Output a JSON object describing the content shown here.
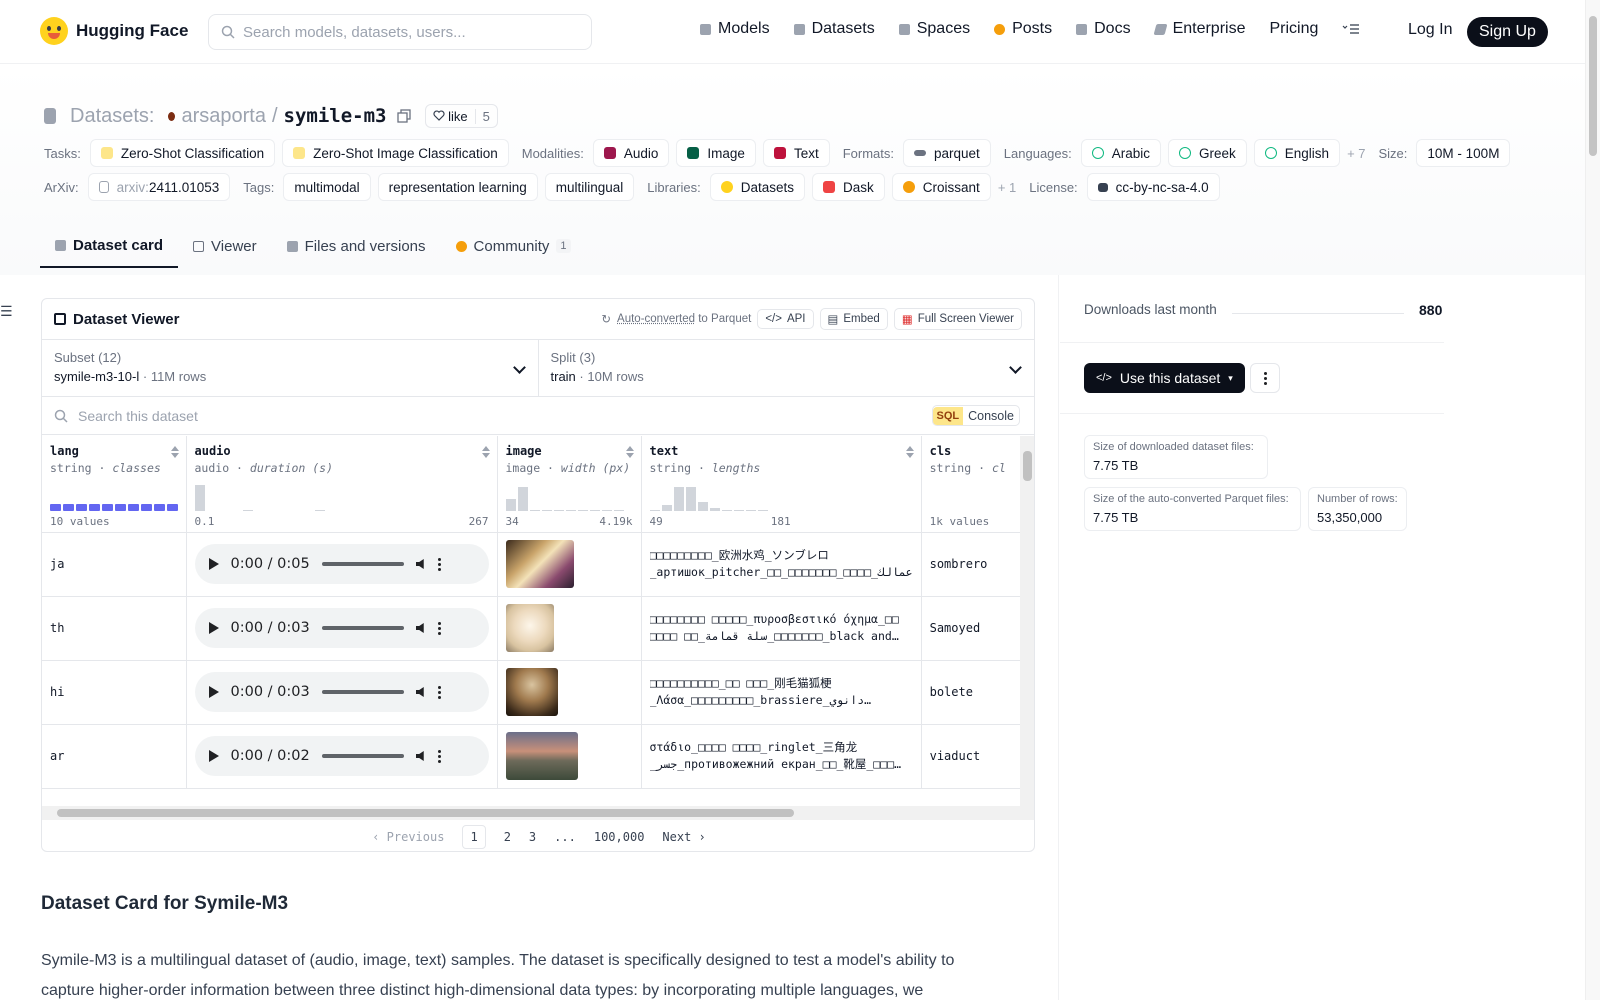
{
  "header": {
    "brand": "Hugging Face",
    "search_placeholder": "Search models, datasets, users...",
    "nav": [
      "Models",
      "Datasets",
      "Spaces",
      "Posts",
      "Docs",
      "Enterprise",
      "Pricing"
    ],
    "login": "Log In",
    "signup": "Sign Up"
  },
  "repo": {
    "section": "Datasets:",
    "owner": "arsaporta",
    "name": "symile-m3",
    "like_label": "like",
    "like_count": "5"
  },
  "tags": {
    "tasks_label": "Tasks:",
    "tasks": [
      "Zero-Shot Classification",
      "Zero-Shot Image Classification"
    ],
    "modalities_label": "Modalities:",
    "modalities": [
      "Audio",
      "Image",
      "Text"
    ],
    "formats_label": "Formats:",
    "formats": [
      "parquet"
    ],
    "languages_label": "Languages:",
    "languages": [
      "Arabic",
      "Greek",
      "English"
    ],
    "languages_more": "+ 7",
    "size_label": "Size:",
    "size": "10M - 100M",
    "arxiv_label": "ArXiv:",
    "arxiv_prefix": "arxiv:",
    "arxiv": "2411.01053",
    "tags_label": "Tags:",
    "tag_items": [
      "multimodal",
      "representation learning",
      "multilingual"
    ],
    "libraries_label": "Libraries:",
    "libraries": [
      "Datasets",
      "Dask",
      "Croissant"
    ],
    "libraries_more": "+ 1",
    "license_label": "License:",
    "license": "cc-by-nc-sa-4.0"
  },
  "tabs": [
    {
      "label": "Dataset card"
    },
    {
      "label": "Viewer"
    },
    {
      "label": "Files and versions"
    },
    {
      "label": "Community",
      "badge": "1"
    }
  ],
  "viewer": {
    "title": "Dataset Viewer",
    "auto_converted": "Auto-converted",
    "to_parquet": " to Parquet",
    "api": "API",
    "embed": "Embed",
    "fullscreen": "Full Screen Viewer",
    "subset_label": "Subset (12)",
    "subset_value": "symile-m3-10-l",
    "subset_rows": "11M rows",
    "split_label": "Split (3)",
    "split_value": "train",
    "split_rows": "10M rows",
    "search_placeholder": "Search this dataset",
    "sql": "SQL",
    "console": "Console",
    "columns": [
      {
        "name": "lang",
        "type": "string",
        "stat": "classes",
        "min": "10 values",
        "max": ""
      },
      {
        "name": "audio",
        "type": "audio",
        "stat": "duration (s)",
        "min": "0.1",
        "max": "267"
      },
      {
        "name": "image",
        "type": "image",
        "stat": "width (px)",
        "min": "34",
        "max": "4.19k"
      },
      {
        "name": "text",
        "type": "string",
        "stat": "lengths",
        "min": "49",
        "max": "181"
      },
      {
        "name": "cls",
        "type": "string",
        "stat": "cl",
        "min": "1k values",
        "max": ""
      }
    ],
    "rows": [
      {
        "lang": "ja",
        "time": "0:00 / 0:05",
        "text1": "□□□□□□□□□_欧洲水鸡_ソンブレロ",
        "text2": "_артишок_pitcher_□□_□□□□□□□_□□□□_عمالك",
        "cls": "sombrero"
      },
      {
        "lang": "th",
        "time": "0:00 / 0:03",
        "text1": "□□□□□□□□ □□□□□_πυροσβεστικό όχημα_□□",
        "text2": "□□□□ □□_سلة قمامة_□□□□□□□_black and…",
        "cls": "Samoyed"
      },
      {
        "lang": "hi",
        "time": "0:00 / 0:03",
        "text1": "□□□□□□□□□□_□□ □□□_刚毛猫狐梗",
        "text2": "_Λάσα_□□□□□□□□□_brassiere_دانوي…",
        "cls": "bolete"
      },
      {
        "lang": "ar",
        "time": "0:00 / 0:02",
        "text1": "στάδιο_□□□□ □□□□_ringlet_三角龙",
        "text2": "_جسر_противожежний екран_□□_靴屋_□□□…",
        "cls": "viaduct"
      }
    ],
    "pager": {
      "prev": "Previous",
      "pages": [
        "1",
        "2",
        "3",
        "...",
        "100,000"
      ],
      "next": "Next"
    }
  },
  "sidebar": {
    "downloads_label": "Downloads last month",
    "downloads": "880",
    "use_button": "Use this dataset",
    "stats": [
      {
        "label": "Size of downloaded dataset files:",
        "value": "7.75 TB"
      },
      {
        "label": "Size of the auto-converted Parquet files:",
        "value": "7.75 TB"
      },
      {
        "label": "Number of rows:",
        "value": "53,350,000"
      }
    ]
  },
  "card": {
    "title": "Dataset Card for Symile-M3",
    "paragraph": "Symile-M3 is a multilingual dataset of (audio, image, text) samples. The dataset is specifically designed to test a model's ability to capture higher-order information between three distinct high-dimensional data types: by incorporating multiple languages, we"
  },
  "colors": {
    "accent": "#0b0f19",
    "brand": "#ffd21e",
    "hist_blue": "#6366f1"
  }
}
